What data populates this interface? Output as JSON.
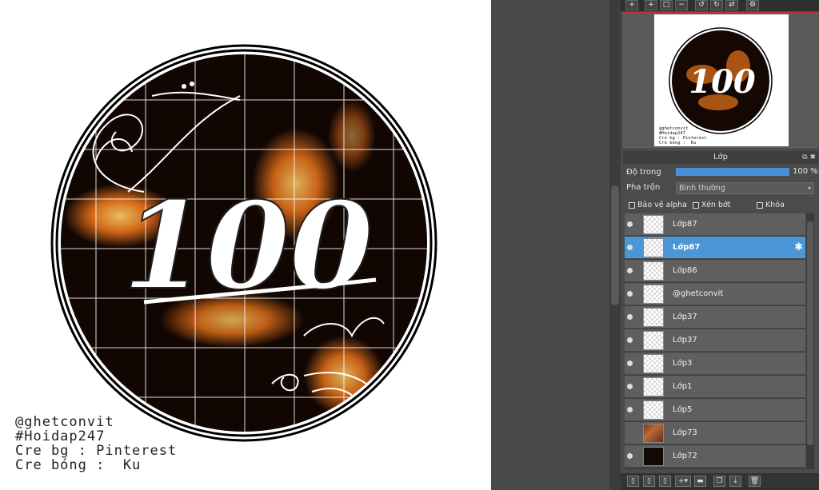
{
  "artwork": {
    "number": "100",
    "caption_lines": [
      "@ghetconvit",
      "#Hoidap247",
      "Cre bg : Pinterest",
      "Cre bóng :  Ku"
    ]
  },
  "toolbar": {
    "icons": [
      "zoom-in-icon",
      "zoom-in-icon",
      "fit-icon",
      "zoom-out-icon",
      "rotate-left-icon",
      "rotate-right-icon",
      "flip-icon",
      "settings-icon"
    ]
  },
  "layer_panel": {
    "title": "Lớp",
    "opacity_label": "Độ trong",
    "opacity_value": "100 %",
    "opacity_fraction": 1.0,
    "blend_label": "Pha trộn",
    "blend_value": "Bình thường",
    "protect_alpha_label": "Bảo vệ alpha",
    "clip_label": "Xén bớt",
    "lock_label": "Khóa",
    "layers": [
      {
        "name": "Lớp87",
        "selected": false,
        "visible": true,
        "thumb": "transparent"
      },
      {
        "name": "Lớp87",
        "selected": true,
        "visible": true,
        "thumb": "transparent"
      },
      {
        "name": "Lớp86",
        "selected": false,
        "visible": true,
        "thumb": "transparent"
      },
      {
        "name": "@ghetconvit",
        "selected": false,
        "visible": true,
        "thumb": "text"
      },
      {
        "name": "Lớp37",
        "selected": false,
        "visible": true,
        "thumb": "transparent"
      },
      {
        "name": "Lớp37",
        "selected": false,
        "visible": true,
        "thumb": "transparent"
      },
      {
        "name": "Lớp3",
        "selected": false,
        "visible": true,
        "thumb": "circle"
      },
      {
        "name": "Lớp1",
        "selected": false,
        "visible": true,
        "thumb": "transparent"
      },
      {
        "name": "Lớp5",
        "selected": false,
        "visible": true,
        "thumb": "transparent"
      },
      {
        "name": "Lớp73",
        "selected": false,
        "visible": false,
        "thumb": "brown"
      },
      {
        "name": "Lớp72",
        "selected": false,
        "visible": true,
        "thumb": "fire"
      }
    ]
  },
  "colors": {
    "selected_layer": "#4a96d6",
    "opacity_bar": "#4a90d9",
    "fire": "#e8731a"
  }
}
